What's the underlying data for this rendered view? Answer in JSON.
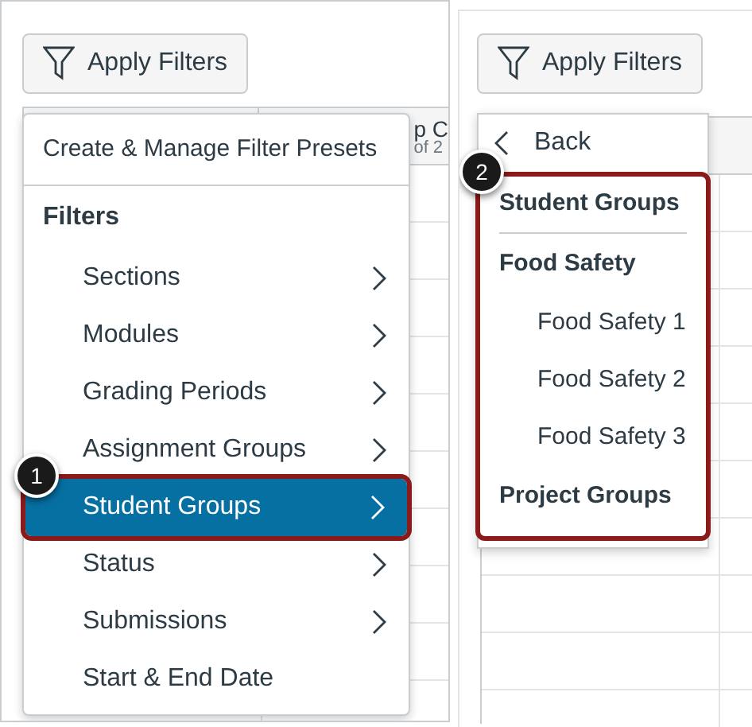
{
  "left_panel": {
    "apply_button": "Apply Filters",
    "header_fragments": [
      "p C",
      "of 2"
    ],
    "menu": {
      "presets": "Create & Manage Filter Presets",
      "heading": "Filters",
      "items": [
        {
          "label": "Sections",
          "has_submenu": true,
          "selected": false
        },
        {
          "label": "Modules",
          "has_submenu": true,
          "selected": false
        },
        {
          "label": "Grading Periods",
          "has_submenu": true,
          "selected": false
        },
        {
          "label": "Assignment Groups",
          "has_submenu": true,
          "selected": false
        },
        {
          "label": "Student Groups",
          "has_submenu": true,
          "selected": true
        },
        {
          "label": "Status",
          "has_submenu": true,
          "selected": false
        },
        {
          "label": "Submissions",
          "has_submenu": true,
          "selected": false
        },
        {
          "label": "Start & End Date",
          "has_submenu": false,
          "selected": false
        }
      ]
    },
    "callout": "1"
  },
  "right_panel": {
    "apply_button": "Apply Filters",
    "back": "Back",
    "submenu": {
      "title": "Student Groups",
      "groups": [
        {
          "label": "Food Safety",
          "children": [
            {
              "label": "Food Safety 1"
            },
            {
              "label": "Food Safety 2"
            },
            {
              "label": "Food Safety 3"
            }
          ]
        },
        {
          "label": "Project Groups"
        }
      ]
    },
    "callout": "2"
  }
}
